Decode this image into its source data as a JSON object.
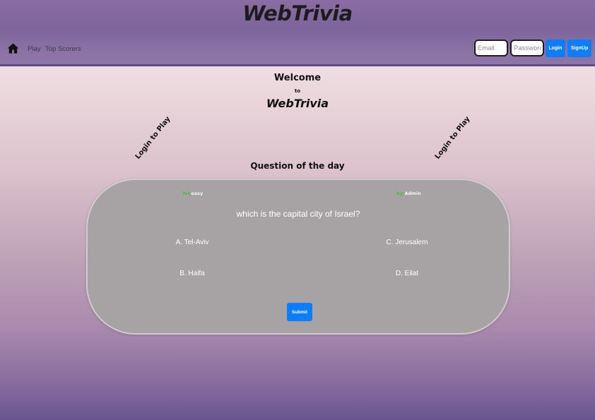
{
  "header": {
    "brand": "WebTrivia",
    "nav": {
      "play": "Play",
      "top_scorers": "Top Scorers"
    },
    "auth": {
      "email_placeholder": "Email",
      "password_placeholder": "Password",
      "login_label": "Login",
      "signup_label": "SignUp"
    }
  },
  "welcome": {
    "line1": "Welcome",
    "line2": "to",
    "line3": "WebTrivia"
  },
  "side_prompts": {
    "left": "Login to Play",
    "right": "Login to Play"
  },
  "question_of_day": {
    "heading": "Question of the day",
    "level_key": "lvl:",
    "level_value": "easy",
    "author_key": "by:",
    "author_value": "Admin",
    "question": "which is the capital city of Israel?",
    "answers": {
      "a": "A. Tel-Aviv",
      "b": "B. Haifa",
      "c": "C. Jerusalem",
      "d": "D. Eilat"
    },
    "submit_label": "Submit"
  },
  "colors": {
    "header_bg": "#7d649b",
    "accent_button": "#0d7dfc",
    "card_bg": "#a7a3a4",
    "level_key_color": "#3bbf3a"
  },
  "icons": {
    "home": "home-icon"
  }
}
